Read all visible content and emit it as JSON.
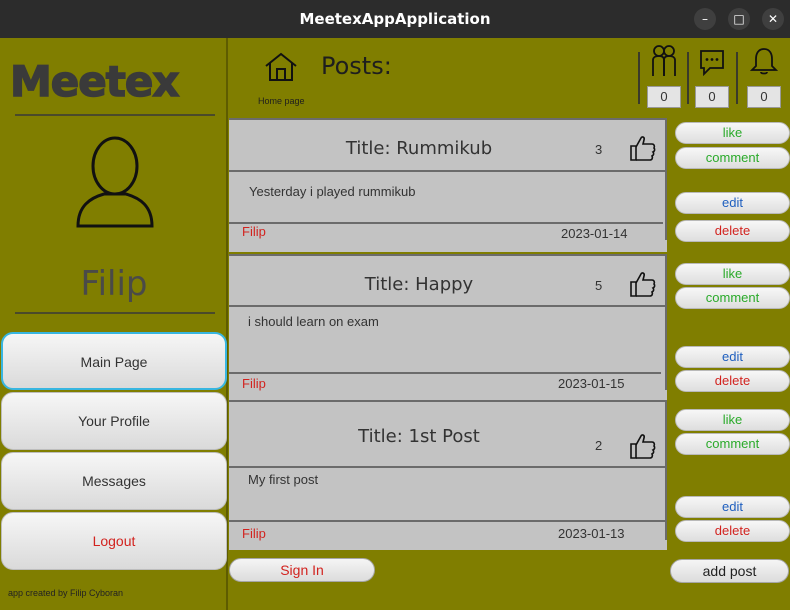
{
  "window": {
    "title": "MeetexAppApplication",
    "minimize": "–",
    "maximize": "□",
    "close": "✕"
  },
  "sidebar": {
    "logo": "Meetex",
    "username": "Filip",
    "nav": [
      {
        "label": "Main Page"
      },
      {
        "label": "Your Profile"
      },
      {
        "label": "Messages"
      },
      {
        "label": "Logout"
      }
    ],
    "credit": "app created by Filip Cyboran"
  },
  "header": {
    "title": "Posts:",
    "home_label": "Home page",
    "counters": {
      "friends": "0",
      "messages": "0",
      "notifications": "0"
    }
  },
  "posts": [
    {
      "title": "Title: Rummikub",
      "likes": "3",
      "body": "Yesterday i played rummikub",
      "author": "Filip",
      "date": "2023-01-14"
    },
    {
      "title": "Title: Happy",
      "likes": "5",
      "body": "i should learn on exam",
      "author": "Filip",
      "date": "2023-01-15"
    },
    {
      "title": "Title: 1st Post",
      "likes": "2",
      "body": "My first post",
      "author": "Filip",
      "date": "2023-01-13"
    }
  ],
  "actions": {
    "like": "like",
    "comment": "comment",
    "edit": "edit",
    "delete": "delete"
  },
  "footer": {
    "sign_in": "Sign In",
    "add_post": "add post"
  },
  "colors": {
    "background": "#807e00",
    "card": "#c3c3c3",
    "accent_green": "#2aaa2a",
    "accent_red": "#d2231f"
  }
}
